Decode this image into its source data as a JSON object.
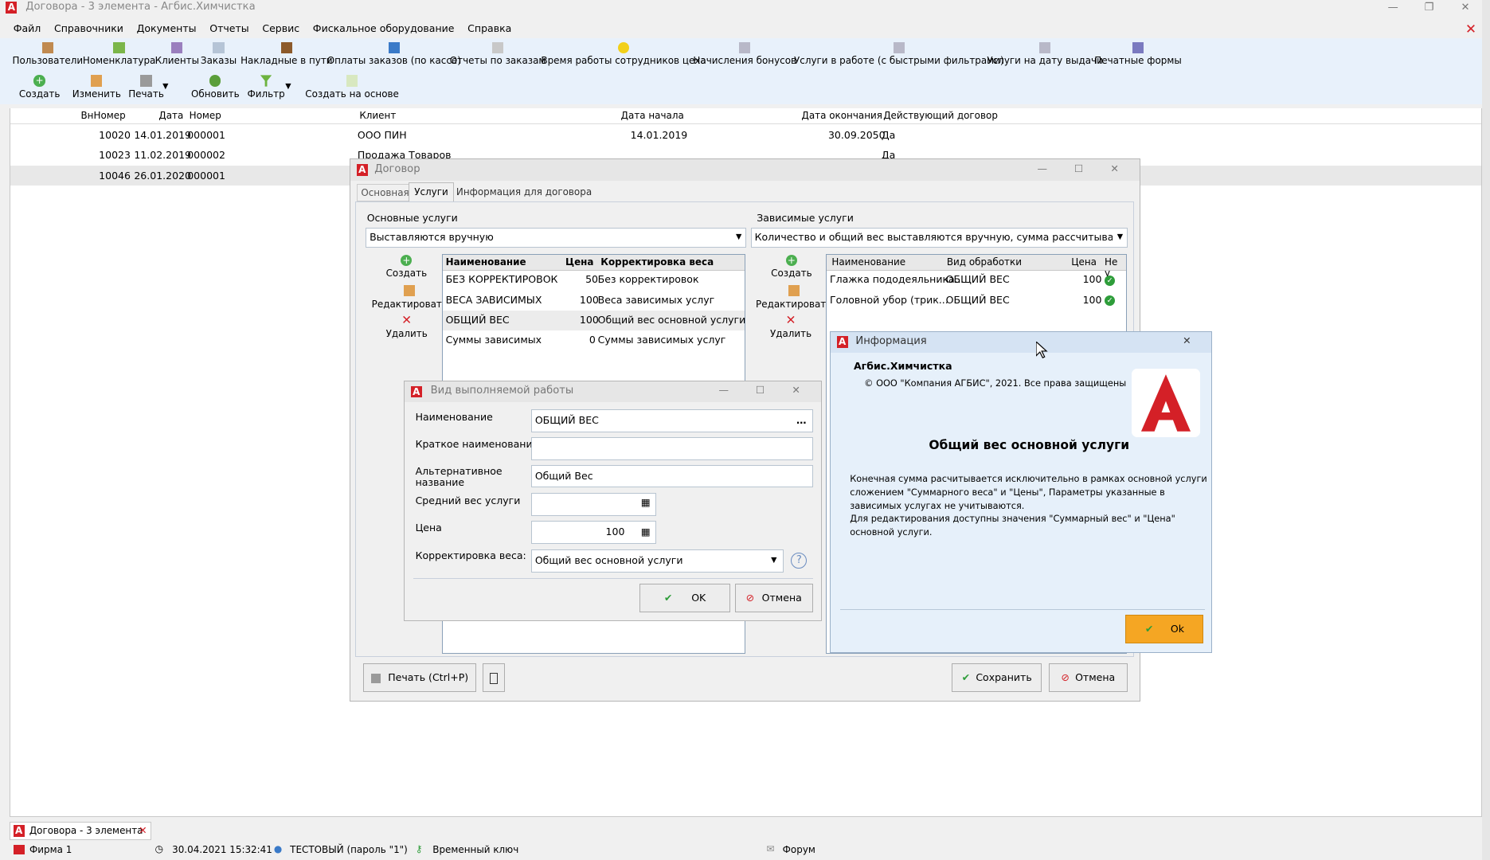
{
  "app": {
    "title": "Договора - 3 элемента - Агбис.Химчистка"
  },
  "menu": [
    "Файл",
    "Справочники",
    "Документы",
    "Отчеты",
    "Сервис",
    "Фискальное оборудование",
    "Справка"
  ],
  "toolbar1": [
    "Пользователи",
    "Номенклатура",
    "Клиенты",
    "Заказы",
    "Накладные в пути",
    "Оплаты заказов (по кассе)",
    "Отчеты по заказам",
    "Время работы сотрудников цеха",
    "Начисления бонусов",
    "Услуги в работе (с быстрыми фильтрами)",
    "Услуги на дату выдачи",
    "Печатные формы"
  ],
  "toolbar2": [
    "Создать",
    "Изменить",
    "Печать",
    "Обновить",
    "Фильтр",
    "Создать на основе"
  ],
  "grid": {
    "headers": [
      "ВнНомер",
      "Дата",
      "Номер",
      "Клиент",
      "Дата начала",
      "Дата окончания",
      "Действующий договор"
    ],
    "rows": [
      [
        "10020",
        "14.01.2019",
        "000001",
        "ООО ПИН",
        "14.01.2019",
        "30.09.2050",
        "Да"
      ],
      [
        "10023",
        "11.02.2019",
        "000002",
        "Продажа Товаров",
        "",
        "",
        "Да"
      ],
      [
        "10046",
        "26.01.2020",
        "000001",
        "",
        "",
        "",
        ""
      ]
    ]
  },
  "dogovor": {
    "title": "Договор",
    "tabs": [
      "Основная",
      "Услуги",
      "Информация для договора"
    ],
    "main_label": "Основные услуги",
    "main_select": "Выставляются вручную",
    "dep_label": "Зависимые услуги",
    "dep_select": "Количество и общий вес выставляются вручную, сумма рассчитывается по обы",
    "actions": [
      "Создать",
      "Редактировать",
      "Удалить"
    ],
    "main_table": {
      "headers": [
        "Наименование",
        "Цена",
        "Корректировка веса"
      ],
      "rows": [
        [
          "БЕЗ КОРРЕКТИРОВОК",
          "50",
          "Без корректировок"
        ],
        [
          "ВЕСА ЗАВИСИМЫХ",
          "100",
          "Веса зависимых услуг"
        ],
        [
          "ОБЩИЙ ВЕС",
          "100",
          "Общий вес основной услуги"
        ],
        [
          "Суммы зависимых",
          "0",
          "Суммы зависимых услуг"
        ]
      ]
    },
    "dep_table": {
      "headers": [
        "Наименование",
        "Вид обработки",
        "Цена",
        "Не у"
      ],
      "rows": [
        [
          "Глажка пододеяльника...",
          "ОБЩИЙ ВЕС",
          "100"
        ],
        [
          "Головной убор (трик...",
          "ОБЩИЙ ВЕС",
          "100"
        ]
      ]
    },
    "print_btn": "Печать (Ctrl+P)",
    "save_btn": "Сохранить",
    "cancel_btn": "Отмена"
  },
  "vid": {
    "title": "Вид выполняемой работы",
    "labels": {
      "name": "Наименование",
      "short": "Краткое наименование",
      "alt": "Альтернативное название",
      "avg": "Средний вес услуги",
      "price": "Цена",
      "corr": "Корректировка веса:"
    },
    "values": {
      "name": "ОБЩИЙ ВЕС",
      "short": "",
      "alt": "Общий Вес",
      "avg": "",
      "price": "100",
      "corr": "Общий вес основной услуги"
    },
    "ok": "OK",
    "cancel": "Отмена"
  },
  "info": {
    "title": "Информация",
    "app_name": "Агбис.Химчистка",
    "copyright": "© ООО \"Компания АГБИС\", 2021. Все права защищены",
    "heading": "Общий вес основной услуги",
    "body": [
      "Конечная сумма расчитывается исключительно в рамках основной услуги",
      "сложением \"Суммарного веса\" и \"Цены\", Параметры указанные в",
      "зависимых услугах не учитываются.",
      "Для редактирования доступны значения \"Суммарный вес\" и \"Цена\"",
      "основной услуги."
    ],
    "ok": "Ok"
  },
  "tabbar": {
    "tab": "Договора - 3 элемента"
  },
  "status": {
    "firm": "Фирма 1",
    "datetime": "30.04.2021 15:32:41",
    "user": "ТЕСТОВЫЙ (пароль \"1\")",
    "key": "Временный ключ",
    "forum": "Форум"
  },
  "colors": {
    "accent": "#d42027",
    "ok_orange": "#f5a623",
    "check_green": "#2e9d3a"
  }
}
